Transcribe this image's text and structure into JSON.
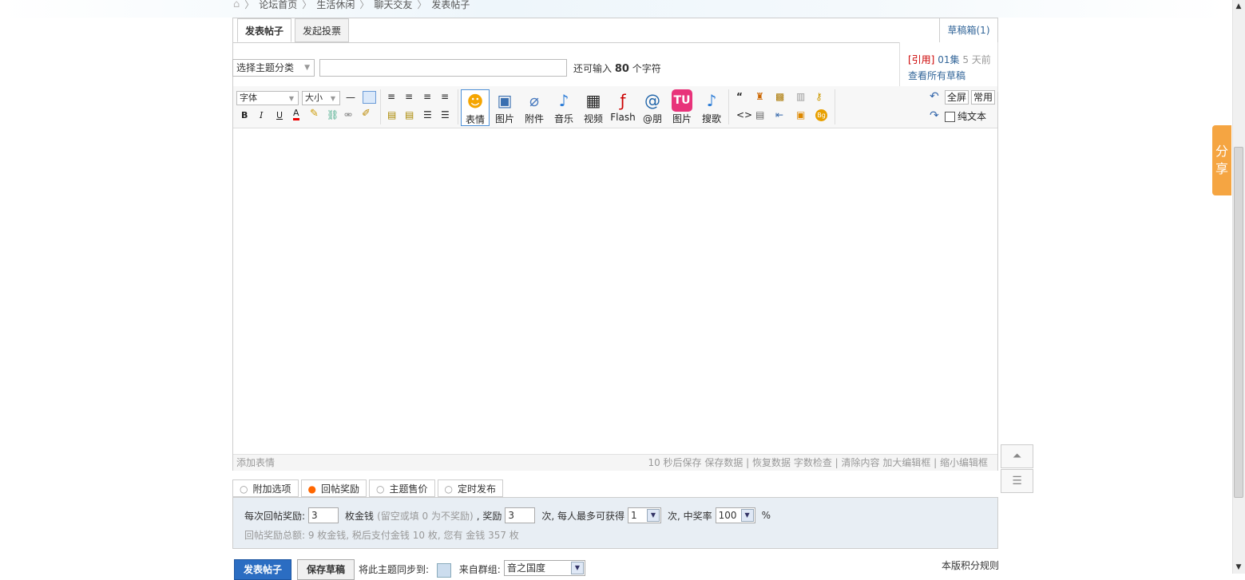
{
  "breadcrumb": {
    "home_icon": "home-icon",
    "items": [
      "论坛首页",
      "生活休闲",
      "聊天交友",
      "发表帖子"
    ]
  },
  "tabs": {
    "post": "发表帖子",
    "poll": "发起投票"
  },
  "draft": {
    "button": "草稿箱(1)",
    "cite": "[引用]",
    "name": "01集",
    "time": "5 天前",
    "view_all": "查看所有草稿"
  },
  "title_row": {
    "type_select": "选择主题分类",
    "remain_prefix": "还可输入",
    "remain_count": "80",
    "remain_suffix": "个字符"
  },
  "toolbar": {
    "font": "字体",
    "size": "大小",
    "fullscreen": "全屏",
    "common": "常用",
    "plain_text": "纯文本",
    "buttons": [
      {
        "label": "表情",
        "icon": "smiley-icon"
      },
      {
        "label": "图片",
        "icon": "image-icon"
      },
      {
        "label": "附件",
        "icon": "paperclip-icon"
      },
      {
        "label": "音乐",
        "icon": "music-icon"
      },
      {
        "label": "视频",
        "icon": "video-icon"
      },
      {
        "label": "Flash",
        "icon": "flash-icon"
      },
      {
        "label": "@朋",
        "icon": "at-icon"
      },
      {
        "label": "图片",
        "icon": "tu-icon"
      },
      {
        "label": "搜歌",
        "icon": "music-search-icon"
      }
    ]
  },
  "statusbar": {
    "left": "添加表情",
    "right": "10 秒后保存 保存数据 | 恢复数据   字数检查 | 清除内容   加大编辑框 | 缩小编辑框"
  },
  "options": {
    "tabs": [
      "附加选项",
      "回帖奖励",
      "主题售价",
      "定时发布"
    ],
    "reward_label": "每次回帖奖励:",
    "reward_value": "3",
    "unit": "枚金钱",
    "hint": "(留空或填 0 为不奖励)",
    "times_label": ", 奖励",
    "times_value": "3",
    "max_label": "次, 每人最多可获得",
    "max_value": "1",
    "rate_label": "次, 中奖率",
    "rate_value": "100",
    "percent": "%",
    "summary": "回帖奖励总额: 9 枚金钱, 税后支付金钱 10 枚, 您有 金钱 357 枚"
  },
  "footer": {
    "submit": "发表帖子",
    "save_draft": "保存草稿",
    "sync_label": "将此主题同步到:",
    "group_label": "来自群组:",
    "group_value": "音之国度",
    "rules": "本版积分规则"
  },
  "side": {
    "share": "分享"
  }
}
